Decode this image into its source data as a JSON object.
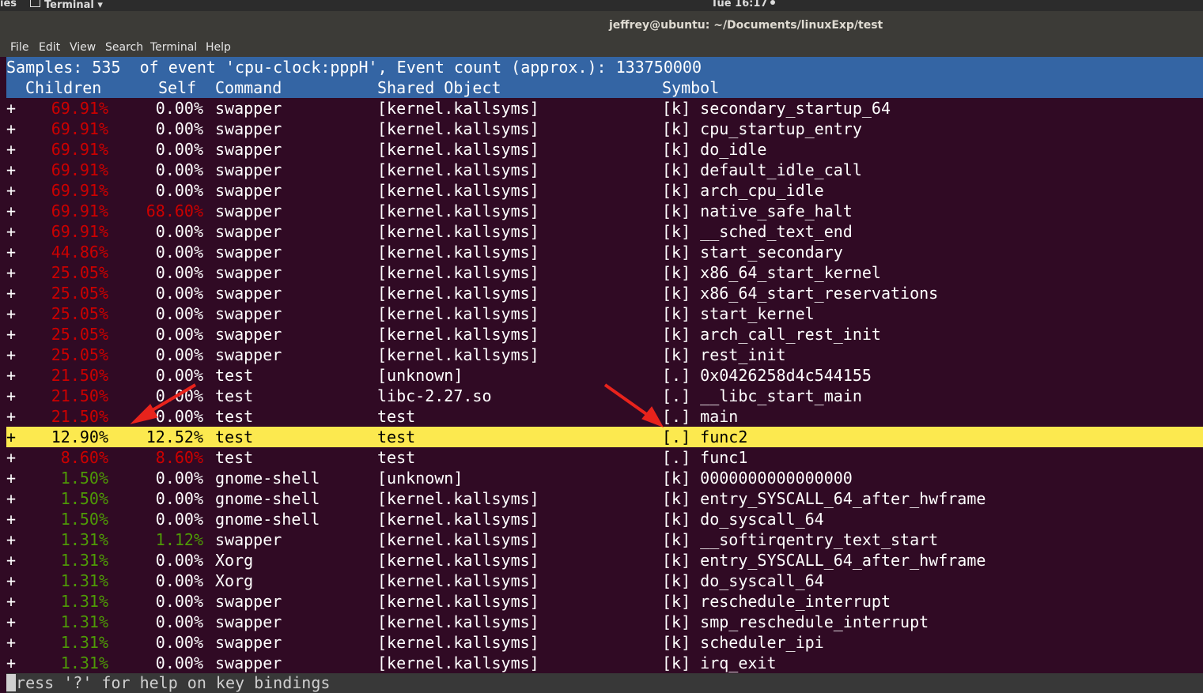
{
  "topbar": {
    "activities": "ies",
    "app_menu": "Terminal ▾",
    "clock": "Tue 16:17"
  },
  "window": {
    "title": "jeffrey@ubuntu: ~/Documents/linuxExp/test"
  },
  "menu": [
    "File",
    "Edit",
    "View",
    "Search",
    "Terminal",
    "Help"
  ],
  "perf": {
    "summary": "Samples: 535  of event 'cpu-clock:pppH', Event count (approx.): 133750000",
    "columns": {
      "children": "Children",
      "self": "Self",
      "command": "Command",
      "shared_object": "Shared Object",
      "symbol": "Symbol"
    },
    "rows": [
      {
        "expand": "+",
        "children": "69.91%",
        "self": "0.00%",
        "command": "swapper",
        "object": "[kernel.kallsyms]",
        "symbol": "[k] secondary_startup_64",
        "children_color": "red",
        "self_color": "white"
      },
      {
        "expand": "+",
        "children": "69.91%",
        "self": "0.00%",
        "command": "swapper",
        "object": "[kernel.kallsyms]",
        "symbol": "[k] cpu_startup_entry",
        "children_color": "red",
        "self_color": "white"
      },
      {
        "expand": "+",
        "children": "69.91%",
        "self": "0.00%",
        "command": "swapper",
        "object": "[kernel.kallsyms]",
        "symbol": "[k] do_idle",
        "children_color": "red",
        "self_color": "white"
      },
      {
        "expand": "+",
        "children": "69.91%",
        "self": "0.00%",
        "command": "swapper",
        "object": "[kernel.kallsyms]",
        "symbol": "[k] default_idle_call",
        "children_color": "red",
        "self_color": "white"
      },
      {
        "expand": "+",
        "children": "69.91%",
        "self": "0.00%",
        "command": "swapper",
        "object": "[kernel.kallsyms]",
        "symbol": "[k] arch_cpu_idle",
        "children_color": "red",
        "self_color": "white"
      },
      {
        "expand": "+",
        "children": "69.91%",
        "self": "68.60%",
        "command": "swapper",
        "object": "[kernel.kallsyms]",
        "symbol": "[k] native_safe_halt",
        "children_color": "red",
        "self_color": "red"
      },
      {
        "expand": "+",
        "children": "69.91%",
        "self": "0.00%",
        "command": "swapper",
        "object": "[kernel.kallsyms]",
        "symbol": "[k] __sched_text_end",
        "children_color": "red",
        "self_color": "white"
      },
      {
        "expand": "+",
        "children": "44.86%",
        "self": "0.00%",
        "command": "swapper",
        "object": "[kernel.kallsyms]",
        "symbol": "[k] start_secondary",
        "children_color": "red",
        "self_color": "white"
      },
      {
        "expand": "+",
        "children": "25.05%",
        "self": "0.00%",
        "command": "swapper",
        "object": "[kernel.kallsyms]",
        "symbol": "[k] x86_64_start_kernel",
        "children_color": "red",
        "self_color": "white"
      },
      {
        "expand": "+",
        "children": "25.05%",
        "self": "0.00%",
        "command": "swapper",
        "object": "[kernel.kallsyms]",
        "symbol": "[k] x86_64_start_reservations",
        "children_color": "red",
        "self_color": "white"
      },
      {
        "expand": "+",
        "children": "25.05%",
        "self": "0.00%",
        "command": "swapper",
        "object": "[kernel.kallsyms]",
        "symbol": "[k] start_kernel",
        "children_color": "red",
        "self_color": "white"
      },
      {
        "expand": "+",
        "children": "25.05%",
        "self": "0.00%",
        "command": "swapper",
        "object": "[kernel.kallsyms]",
        "symbol": "[k] arch_call_rest_init",
        "children_color": "red",
        "self_color": "white"
      },
      {
        "expand": "+",
        "children": "25.05%",
        "self": "0.00%",
        "command": "swapper",
        "object": "[kernel.kallsyms]",
        "symbol": "[k] rest_init",
        "children_color": "red",
        "self_color": "white"
      },
      {
        "expand": "+",
        "children": "21.50%",
        "self": "0.00%",
        "command": "test",
        "object": "[unknown]",
        "symbol": "[.] 0x0426258d4c544155",
        "children_color": "red",
        "self_color": "white"
      },
      {
        "expand": "+",
        "children": "21.50%",
        "self": "0.00%",
        "command": "test",
        "object": "libc-2.27.so",
        "symbol": "[.] __libc_start_main",
        "children_color": "red",
        "self_color": "white"
      },
      {
        "expand": "+",
        "children": "21.50%",
        "self": "0.00%",
        "command": "test",
        "object": "test",
        "symbol": "[.] main",
        "children_color": "red",
        "self_color": "white"
      },
      {
        "expand": "+",
        "children": "12.90%",
        "self": "12.52%",
        "command": "test",
        "object": "test",
        "symbol": "[.] func2",
        "children_color": "red",
        "self_color": "red",
        "selected": true
      },
      {
        "expand": "+",
        "children": "8.60%",
        "self": "8.60%",
        "command": "test",
        "object": "test",
        "symbol": "[.] func1",
        "children_color": "red",
        "self_color": "red"
      },
      {
        "expand": "+",
        "children": "1.50%",
        "self": "0.00%",
        "command": "gnome-shell",
        "object": "[unknown]",
        "symbol": "[k] 0000000000000000",
        "children_color": "green",
        "self_color": "white"
      },
      {
        "expand": "+",
        "children": "1.50%",
        "self": "0.00%",
        "command": "gnome-shell",
        "object": "[kernel.kallsyms]",
        "symbol": "[k] entry_SYSCALL_64_after_hwframe",
        "children_color": "green",
        "self_color": "white"
      },
      {
        "expand": "+",
        "children": "1.50%",
        "self": "0.00%",
        "command": "gnome-shell",
        "object": "[kernel.kallsyms]",
        "symbol": "[k] do_syscall_64",
        "children_color": "green",
        "self_color": "white"
      },
      {
        "expand": "+",
        "children": "1.31%",
        "self": "1.12%",
        "command": "swapper",
        "object": "[kernel.kallsyms]",
        "symbol": "[k] __softirqentry_text_start",
        "children_color": "green",
        "self_color": "green"
      },
      {
        "expand": "+",
        "children": "1.31%",
        "self": "0.00%",
        "command": "Xorg",
        "object": "[kernel.kallsyms]",
        "symbol": "[k] entry_SYSCALL_64_after_hwframe",
        "children_color": "green",
        "self_color": "white"
      },
      {
        "expand": "+",
        "children": "1.31%",
        "self": "0.00%",
        "command": "Xorg",
        "object": "[kernel.kallsyms]",
        "symbol": "[k] do_syscall_64",
        "children_color": "green",
        "self_color": "white"
      },
      {
        "expand": "+",
        "children": "1.31%",
        "self": "0.00%",
        "command": "swapper",
        "object": "[kernel.kallsyms]",
        "symbol": "[k] reschedule_interrupt",
        "children_color": "green",
        "self_color": "white"
      },
      {
        "expand": "+",
        "children": "1.31%",
        "self": "0.00%",
        "command": "swapper",
        "object": "[kernel.kallsyms]",
        "symbol": "[k] smp_reschedule_interrupt",
        "children_color": "green",
        "self_color": "white"
      },
      {
        "expand": "+",
        "children": "1.31%",
        "self": "0.00%",
        "command": "swapper",
        "object": "[kernel.kallsyms]",
        "symbol": "[k] scheduler_ipi",
        "children_color": "green",
        "self_color": "white"
      },
      {
        "expand": "+",
        "children": "1.31%",
        "self": "0.00%",
        "command": "swapper",
        "object": "[kernel.kallsyms]",
        "symbol": "[k] irq_exit",
        "children_color": "green",
        "self_color": "white"
      }
    ],
    "status": "ress '?' for help on key bindings",
    "status_first_char": "P"
  },
  "colors": {
    "terminal_bg": "#300a24",
    "header_bg": "#3465a4",
    "selected_bg": "#fce94f",
    "high_pct": "#cc0000",
    "low_pct": "#4e9a06",
    "annotation_arrow": "#e8231c"
  }
}
